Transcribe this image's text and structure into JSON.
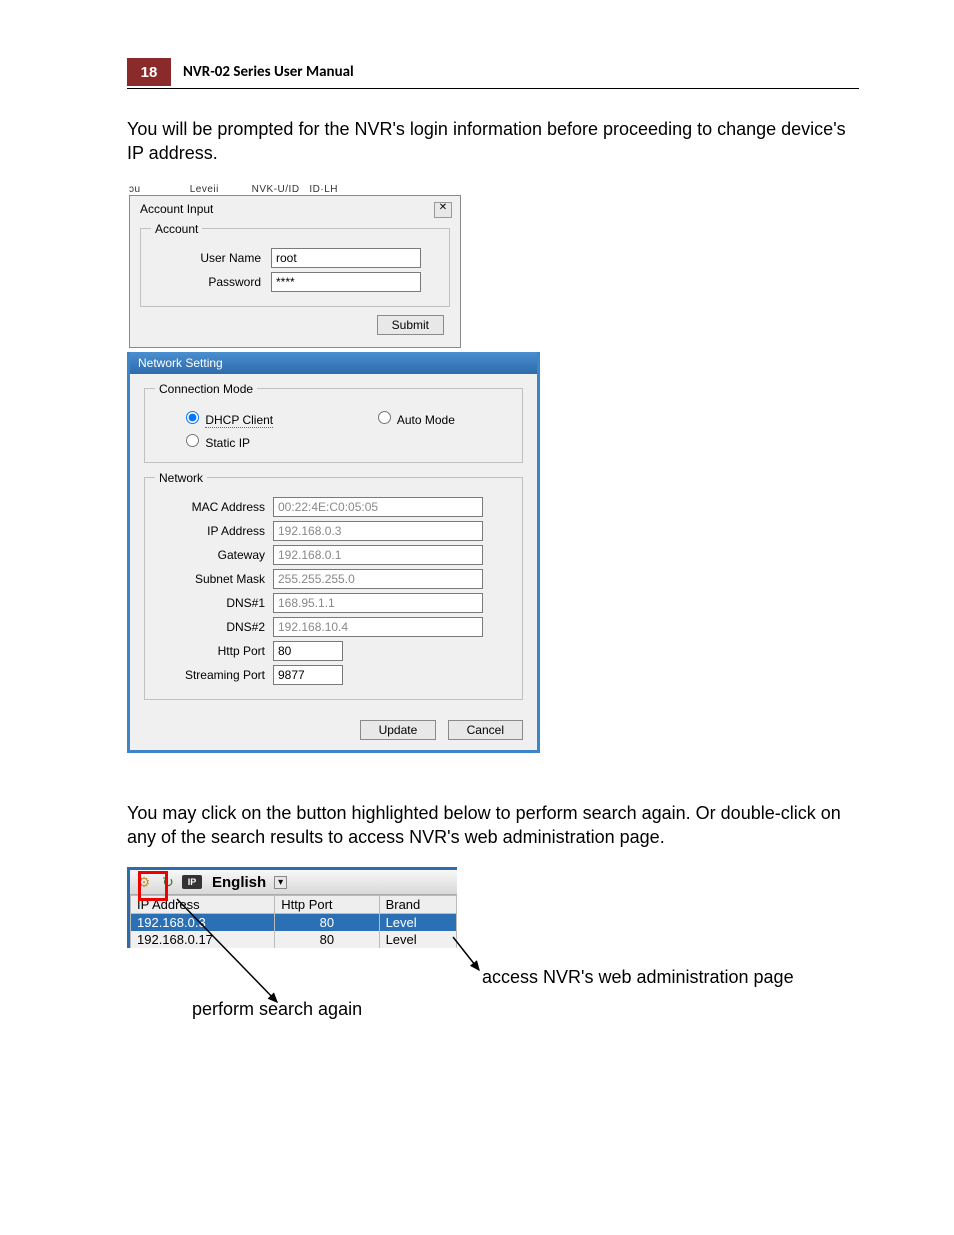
{
  "header": {
    "page_number": "18",
    "title": "NVR-02 Series User Manual"
  },
  "para1": "You will be prompted for the NVR's login information before proceeding to change device's IP address.",
  "cut_text": "ɔu               Leveii          NVK-U/ID   ID·LH",
  "account_dialog": {
    "title": "Account Input",
    "legend": "Account",
    "user_label": "User Name",
    "user_value": "root",
    "pass_label": "Password",
    "pass_value": "****",
    "submit": "Submit",
    "close": "✕"
  },
  "network_dialog": {
    "title": "Network Setting",
    "conn_legend": "Connection Mode",
    "opt_dhcp": "DHCP Client",
    "opt_auto": "Auto Mode",
    "opt_static": "Static IP",
    "net_legend": "Network",
    "mac_l": "MAC Address",
    "mac_v": "00:22:4E:C0:05:05",
    "ip_l": "IP Address",
    "ip_v": "192.168.0.3",
    "gw_l": "Gateway",
    "gw_v": "192.168.0.1",
    "sm_l": "Subnet Mask",
    "sm_v": "255.255.255.0",
    "d1_l": "DNS#1",
    "d1_v": "168.95.1.1",
    "d2_l": "DNS#2",
    "d2_v": "192.168.10.4",
    "hp_l": "Http Port",
    "hp_v": "80",
    "sp_l": "Streaming Port",
    "sp_v": "9877",
    "update": "Update",
    "cancel": "Cancel"
  },
  "para2": "You may click on the button highlighted below to perform search again. Or double-click on any of the search results to access NVR's web administration page.",
  "search_tool": {
    "language": "English",
    "cols": {
      "ip": "IP Address",
      "port": "Http Port",
      "brand": "Brand"
    },
    "rows": [
      {
        "ip": "192.168.0.3",
        "port": "80",
        "brand": "Level",
        "selected": true
      },
      {
        "ip": "192.168.0.17",
        "port": "80",
        "brand": "Level",
        "selected": false
      }
    ]
  },
  "annotations": {
    "search_again": "perform search again",
    "web_admin": "access NVR's web administration page"
  }
}
